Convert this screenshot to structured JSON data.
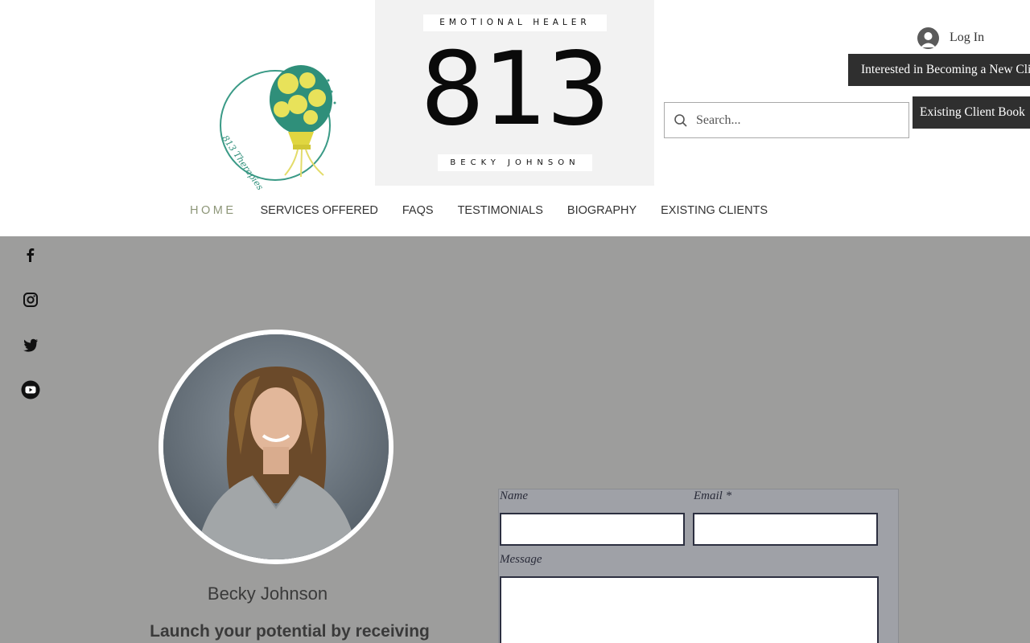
{
  "brand": {
    "logo_text": "813 Therapies",
    "tagline_top": "EMOTIONAL HEALER",
    "number": "813",
    "tagline_bottom": "BECKY JOHNSON"
  },
  "header": {
    "login_label": "Log In",
    "cta_new_client": "Interested in Becoming a New Client",
    "cta_existing_client": "Existing Client Book",
    "search_placeholder": "Search..."
  },
  "nav": {
    "items": [
      {
        "label": "HOME",
        "active": true
      },
      {
        "label": "SERVICES OFFERED"
      },
      {
        "label": "FAQS"
      },
      {
        "label": "TESTIMONIALS"
      },
      {
        "label": "BIOGRAPHY"
      },
      {
        "label": "EXISTING CLIENTS"
      }
    ]
  },
  "social": {
    "items": [
      "facebook-icon",
      "instagram-icon",
      "twitter-icon",
      "youtube-icon"
    ]
  },
  "profile": {
    "name": "Becky Johnson",
    "tagline": "Launch your potential by receiving"
  },
  "contact_form": {
    "name_label": "Name",
    "email_label": "Email *",
    "message_label": "Message"
  },
  "colors": {
    "main_background": "#9d9d9c",
    "button_dark": "#2f2f2f",
    "nav_active": "#8d9678",
    "form_background": "#9fa1a7"
  }
}
